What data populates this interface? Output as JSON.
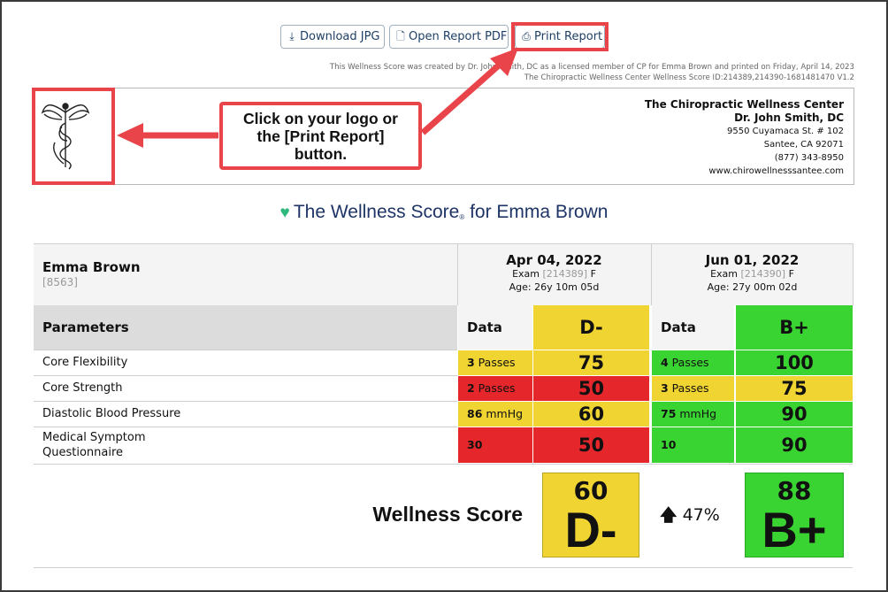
{
  "toolbar": {
    "download_jpg": "Download JPG",
    "open_pdf": "Open Report PDF",
    "print_report": "Print Report"
  },
  "meta": {
    "line1": "This Wellness Score was created by Dr. John Smith, DC as a licensed member of CP for Emma Brown and printed on Friday, April 14, 2023",
    "line2": "The Chiropractic Wellness Center Wellness Score ID:214389,214390-1681481470 V1.2"
  },
  "clinic": {
    "name": "The Chiropractic Wellness Center",
    "doctor": "Dr. John Smith, DC",
    "address": "9550 Cuyamaca St. # 102",
    "city": "Santee, CA 92071",
    "phone": "(877) 343-8950",
    "website": "www.chirowellnesssantee.com"
  },
  "callout": {
    "line1": "Click on your logo or",
    "line2": "the [Print Report]",
    "line3": "button."
  },
  "title": {
    "prefix": "The Wellness Score",
    "reg": "®",
    "suffix": " for Emma Brown"
  },
  "patient": {
    "name": "Emma Brown",
    "id": "[8563]"
  },
  "exams": [
    {
      "date": "Apr 04, 2022",
      "exam_label": "Exam",
      "exam_id": "[214389]",
      "sex": "F",
      "age": "Age: 26y 10m 05d",
      "grade": "D-",
      "score": "60"
    },
    {
      "date": "Jun 01, 2022",
      "exam_label": "Exam",
      "exam_id": "[214390]",
      "sex": "F",
      "age": "Age: 27y 00m 02d",
      "grade": "B+",
      "score": "88"
    }
  ],
  "table": {
    "param_header": "Parameters",
    "data_header": "Data",
    "rows": [
      {
        "name": "Core Flexibility",
        "e1_num": "3",
        "e1_unit": " Passes",
        "e1_score": "75",
        "e2_num": "4",
        "e2_unit": " Passes",
        "e2_score": "100"
      },
      {
        "name": "Core Strength",
        "e1_num": "2",
        "e1_unit": " Passes",
        "e1_score": "50",
        "e2_num": "3",
        "e2_unit": " Passes",
        "e2_score": "75"
      },
      {
        "name": "Diastolic Blood Pressure",
        "e1_num": "86",
        "e1_unit": " mmHg",
        "e1_score": "60",
        "e2_num": "75",
        "e2_unit": " mmHg",
        "e2_score": "90"
      },
      {
        "name_line1": "Medical Symptom",
        "name_line2": "Questionnaire",
        "e1_num": "30",
        "e1_unit": "",
        "e1_score": "50",
        "e2_num": "10",
        "e2_unit": "",
        "e2_score": "90"
      }
    ]
  },
  "summary": {
    "label": "Wellness Score",
    "change": "47%"
  },
  "colors": {
    "yellow": "#f0d431",
    "red": "#e5262a",
    "green": "#3ad432",
    "callout": "#e8444a",
    "navy": "#1e3466"
  }
}
